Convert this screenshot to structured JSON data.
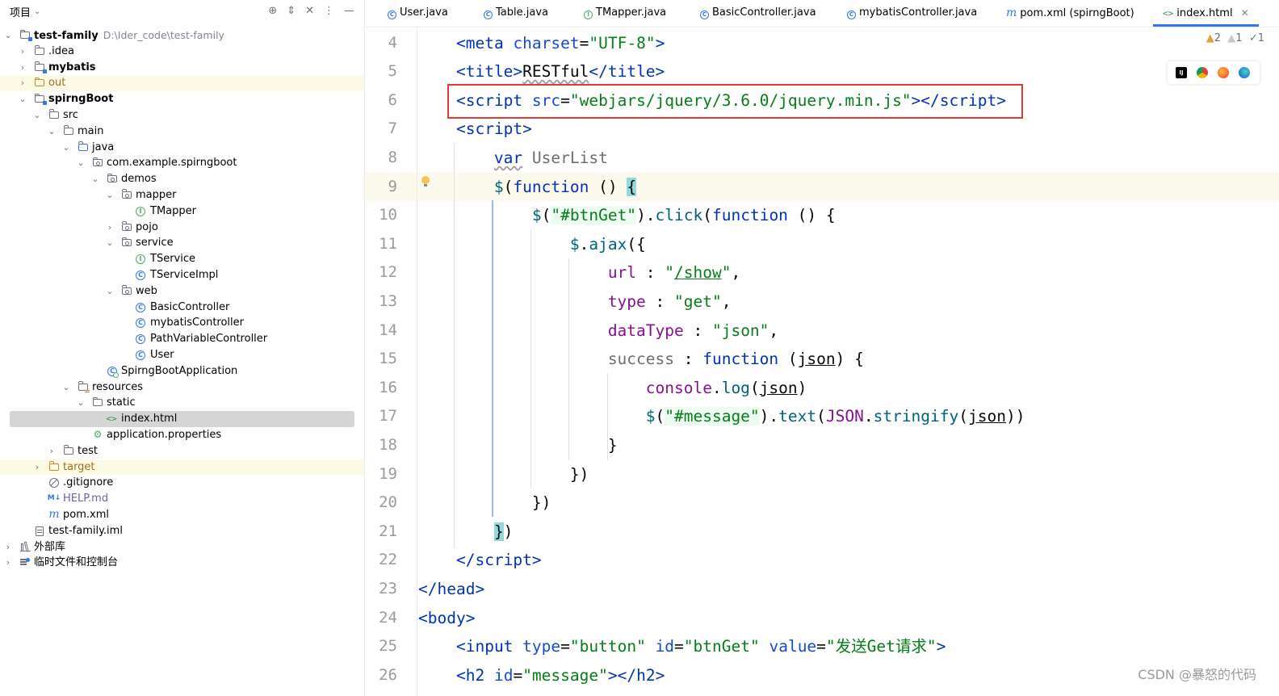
{
  "project_panel": {
    "title": "项目",
    "tree": [
      {
        "label": "test-family",
        "path": "D:\\Ider_code\\test-family",
        "icon": "module-folder-icon",
        "arrow": "⌄",
        "bold": true
      },
      {
        "label": ".idea",
        "icon": "folder-icon",
        "arrow": "›"
      },
      {
        "label": "mybatis",
        "icon": "module-folder-icon",
        "arrow": "›",
        "bold": true
      },
      {
        "label": "out",
        "icon": "excluded-folder-icon",
        "arrow": "›"
      },
      {
        "label": "spirngBoot",
        "icon": "module-folder-icon",
        "arrow": "⌄",
        "bold": true
      },
      {
        "label": "src",
        "icon": "folder-icon",
        "arrow": "⌄"
      },
      {
        "label": "main",
        "icon": "folder-icon",
        "arrow": "⌄"
      },
      {
        "label": "java",
        "icon": "source-folder-icon",
        "arrow": "⌄"
      },
      {
        "label": "com.example.spirngboot",
        "icon": "package-icon",
        "arrow": "⌄"
      },
      {
        "label": "demos",
        "icon": "package-icon",
        "arrow": "⌄"
      },
      {
        "label": "mapper",
        "icon": "package-icon",
        "arrow": "⌄"
      },
      {
        "label": "TMapper",
        "icon": "interface-icon"
      },
      {
        "label": "pojo",
        "icon": "package-icon",
        "arrow": "›"
      },
      {
        "label": "service",
        "icon": "package-icon",
        "arrow": "⌄"
      },
      {
        "label": "TService",
        "icon": "interface-icon"
      },
      {
        "label": "TServiceImpl",
        "icon": "class-icon"
      },
      {
        "label": "web",
        "icon": "package-icon",
        "arrow": "⌄"
      },
      {
        "label": "BasicController",
        "icon": "class-icon"
      },
      {
        "label": "mybatisController",
        "icon": "class-icon"
      },
      {
        "label": "PathVariableController",
        "icon": "class-icon"
      },
      {
        "label": "User",
        "icon": "class-icon"
      },
      {
        "label": "SpirngBootApplication",
        "icon": "spring-app-class-icon"
      },
      {
        "label": "resources",
        "icon": "resources-folder-icon",
        "arrow": "⌄"
      },
      {
        "label": "static",
        "icon": "folder-icon",
        "arrow": "⌄"
      },
      {
        "label": "index.html",
        "icon": "html-file-icon",
        "selected": true
      },
      {
        "label": "application.properties",
        "icon": "properties-file-icon"
      },
      {
        "label": "test",
        "icon": "folder-icon",
        "arrow": "›"
      },
      {
        "label": "target",
        "icon": "excluded-folder-icon",
        "arrow": "›"
      },
      {
        "label": ".gitignore",
        "icon": "gitignore-file-icon"
      },
      {
        "label": "HELP.md",
        "icon": "markdown-file-icon"
      },
      {
        "label": "pom.xml",
        "icon": "maven-file-icon"
      },
      {
        "label": "test-family.iml",
        "icon": "iml-file-icon"
      },
      {
        "label": "外部库",
        "icon": "external-libraries-icon",
        "arrow": "›"
      },
      {
        "label": "临时文件和控制台",
        "icon": "scratches-icon",
        "arrow": "›"
      }
    ]
  },
  "tabs": [
    {
      "label": "User.java",
      "icon": "class-icon"
    },
    {
      "label": "Table.java",
      "icon": "class-icon"
    },
    {
      "label": "TMapper.java",
      "icon": "interface-icon"
    },
    {
      "label": "BasicController.java",
      "icon": "class-icon"
    },
    {
      "label": "mybatisController.java",
      "icon": "class-icon"
    },
    {
      "label": "pom.xml (spirngBoot)",
      "icon": "maven-file-icon"
    },
    {
      "label": "index.html",
      "icon": "html-file-icon",
      "active": true
    }
  ],
  "editor": {
    "line_numbers": [
      "4",
      "5",
      "6",
      "7",
      "8",
      "9",
      "10",
      "11",
      "12",
      "13",
      "14",
      "15",
      "16",
      "17",
      "18",
      "19",
      "20",
      "21",
      "22",
      "23",
      "24",
      "25",
      "26"
    ],
    "current_line": "9",
    "inspections": {
      "warnings": "2",
      "weak_warnings": "1",
      "ok": "1"
    },
    "code": {
      "l4": {
        "open": "<",
        "tag": "meta",
        "attr": "charset",
        "eq": "=",
        "val": "\"UTF-8\"",
        "close": ">"
      },
      "l5": {
        "open": "<",
        "tag": "title",
        "gt": ">",
        "text": "RESTful",
        "close_open": "</",
        "tag2": "title",
        "close": ">"
      },
      "l6": {
        "open": "<",
        "tag": "script",
        "attr": "src",
        "eq": "=",
        "val": "\"webjars/jquery/3.6.0/jquery.min.js\"",
        "mid": "></",
        "tag2": "script",
        "close": ">"
      },
      "l7": {
        "open": "<",
        "tag": "script",
        "close": ">"
      },
      "l8": {
        "kw": "var",
        "name": "UserList"
      },
      "l9": {
        "dollar": "$",
        "paren": "(",
        "kw": "function",
        "rest": " () ",
        "brace": "{"
      },
      "l10": {
        "dollar": "$",
        "p1": "(",
        "str": "\"#btnGet\"",
        "p2": ").",
        "fn": "click",
        "p3": "(",
        "kw": "function",
        "rest": " () {"
      },
      "l11": {
        "dollar": "$",
        "dot": ".",
        "fn": "ajax",
        "rest": "({"
      },
      "l12": {
        "key": "url",
        "colon": " : ",
        "q1": "\"",
        "str": "/show",
        "q2": "\"",
        "comma": ","
      },
      "l13": {
        "key": "type",
        "colon": " : ",
        "str": "\"get\"",
        "comma": ","
      },
      "l14": {
        "key": "dataType",
        "colon": " : ",
        "str": "\"json\"",
        "comma": ","
      },
      "l15": {
        "key": "success",
        "colon": " : ",
        "kw": "function",
        "p1": " (",
        "param": "json",
        "rest": ") {"
      },
      "l16": {
        "obj": "console",
        "dot": ".",
        "fn": "log",
        "p1": "(",
        "param": "json",
        "p2": ")"
      },
      "l17": {
        "dollar": "$",
        "p1": "(",
        "str": "\"#message\"",
        "p2": ").",
        "fn": "text",
        "p3": "(",
        "obj": "JSON",
        "dot": ".",
        "fn2": "stringify",
        "p4": "(",
        "param": "json",
        "p5": "))"
      },
      "l18": {
        "text": "}"
      },
      "l19": {
        "text": "})"
      },
      "l20": {
        "text": "})"
      },
      "l21": {
        "brace": "}",
        "rest": ")"
      },
      "l22": {
        "open": "</",
        "tag": "script",
        "close": ">"
      },
      "l23": {
        "open": "</",
        "tag": "head",
        "close": ">"
      },
      "l24": {
        "open": "<",
        "tag": "body",
        "close": ">"
      },
      "l25": {
        "open": "<",
        "tag": "input",
        "a1": "type",
        "v1": "\"button\"",
        "a2": "id",
        "v2": "\"btnGet\"",
        "a3": "value",
        "v3": "\"发送Get请求\"",
        "close": ">"
      },
      "l26": {
        "open": "<",
        "tag": "h2",
        "a1": "id",
        "v1": "\"message\"",
        "mid": "></",
        "tag2": "h2",
        "close": ">"
      }
    }
  },
  "watermark": "CSDN @暴怒的代码",
  "colors": {
    "accent": "#3574f0",
    "highlight_box": "#e53935",
    "tag": "#0033b3",
    "string": "#067d17",
    "function": "#00627a"
  }
}
